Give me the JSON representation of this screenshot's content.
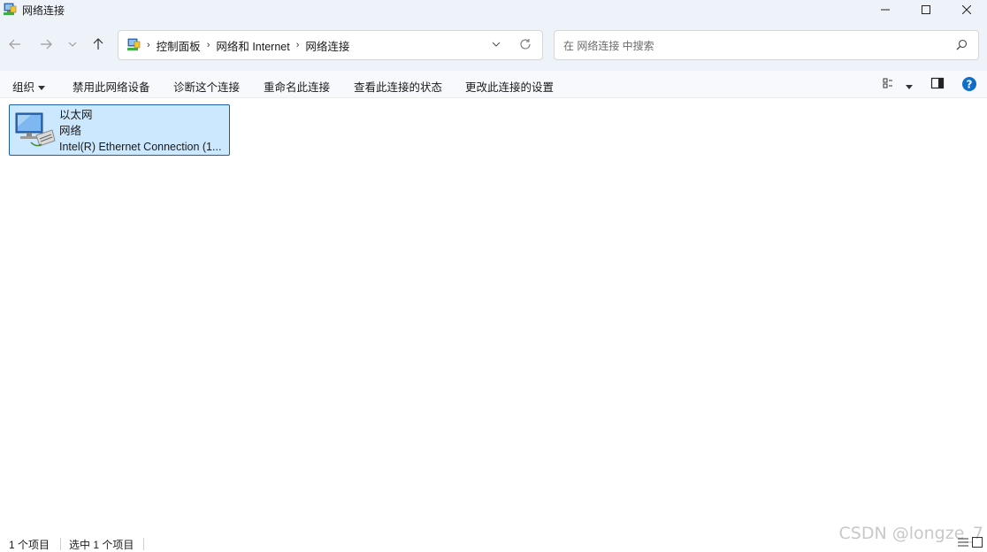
{
  "window": {
    "title": "网络连接",
    "controls": {
      "minimize": "minimize-icon",
      "maximize": "maximize-icon",
      "close": "close-icon"
    }
  },
  "nav": {
    "back": "arrow-left-icon",
    "forward": "arrow-right-icon",
    "recent": "chevron-down-icon",
    "up": "arrow-up-icon"
  },
  "address": {
    "crumbs": [
      "控制面板",
      "网络和 Internet",
      "网络连接"
    ],
    "sep": "›"
  },
  "search": {
    "placeholder": "在 网络连接 中搜索"
  },
  "commands": {
    "organize": "组织",
    "disable": "禁用此网络设备",
    "diagnose": "诊断这个连接",
    "rename": "重命名此连接",
    "status": "查看此连接的状态",
    "settings": "更改此连接的设置"
  },
  "items": [
    {
      "name": "以太网",
      "type": "网络",
      "device": "Intel(R) Ethernet Connection (1..."
    }
  ],
  "statusbar": {
    "count": "1 个项目",
    "selected": "选中 1 个项目"
  },
  "watermark": "CSDN @longze_7",
  "colors": {
    "accent": "#0067c0",
    "selection": "#cce8ff",
    "selection_border": "#1a5ea8"
  }
}
